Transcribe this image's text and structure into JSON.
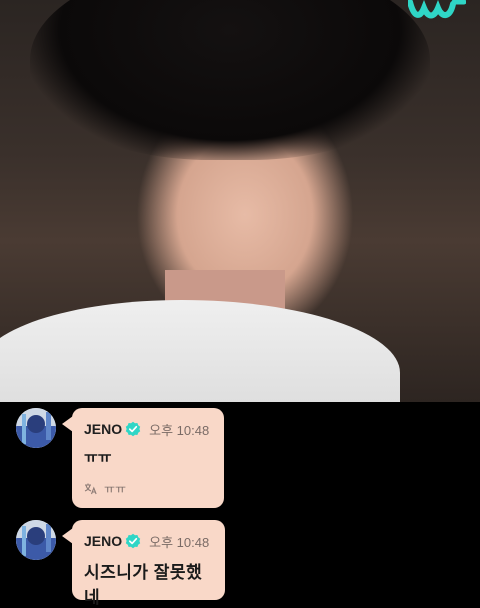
{
  "app": {
    "brand_icon": "weverse-w-logo-icon",
    "accent_color": "#2fd6c6"
  },
  "stream": {
    "background": "live-video-frame"
  },
  "chat": {
    "bubble_color": "#f9d8c8",
    "verified_color": "#2fd6c6",
    "messages": [
      {
        "avatar": "avatar",
        "name": "JENO",
        "verified_icon": "verified-badge-icon",
        "time": "오후 10:48",
        "text": "ㅠㅠ",
        "translation_icon": "translate-icon",
        "translation": "ㅠㅠ"
      },
      {
        "avatar": "avatar",
        "name": "JENO",
        "verified_icon": "verified-badge-icon",
        "time": "오후 10:48",
        "text": "시즈니가 잘못했네"
      }
    ]
  }
}
